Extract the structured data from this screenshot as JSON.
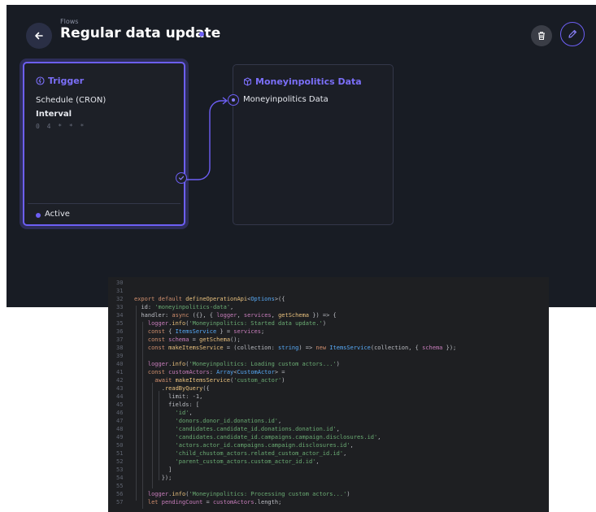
{
  "header": {
    "breadcrumb": "Flows",
    "title": "Regular data update"
  },
  "trigger": {
    "title": "Trigger",
    "type": "Schedule (CRON)",
    "field_label": "Interval",
    "field_value": "0 4 * * *",
    "status": "Active"
  },
  "operation": {
    "title": "Moneyinpolitics Data",
    "subtitle": "Moneyinpolitics Data"
  },
  "colors": {
    "accent": "#6d5ff5",
    "background": "#181c24",
    "card": "#1d2027",
    "code_background": "#1e1f22"
  },
  "icons": {
    "back": "arrow-left-icon",
    "delete": "trash-icon",
    "edit": "pencil-icon",
    "trigger": "bolt-circle-icon",
    "operation": "cube-icon"
  },
  "code": {
    "lines": [
      {
        "n": "30",
        "t": ""
      },
      {
        "n": "31",
        "t": ""
      },
      {
        "n": "32",
        "t": "export default defineOperationApi<Options>({"
      },
      {
        "n": "33",
        "t": "  id: 'moneyinpolitics-data',"
      },
      {
        "n": "34",
        "t": "  handler: async ({}, { logger, services, getSchema }) => {"
      },
      {
        "n": "35",
        "t": "    logger.info('Moneyinpolitics: Started data update.')"
      },
      {
        "n": "36",
        "t": "    const { ItemsService } = services;"
      },
      {
        "n": "37",
        "t": "    const schema = getSchema();"
      },
      {
        "n": "38",
        "t": "    const makeItemsService = (collection: string) => new ItemsService(collection, { schema });"
      },
      {
        "n": "39",
        "t": ""
      },
      {
        "n": "40",
        "t": "    logger.info('Moneyinpolitics: Loading custom actors...')"
      },
      {
        "n": "41",
        "t": "    const customActors: Array<CustomActor> ="
      },
      {
        "n": "42",
        "t": "      await makeItemsService('custom_actor')"
      },
      {
        "n": "43",
        "t": "        .readByQuery({"
      },
      {
        "n": "44",
        "t": "          limit: -1,"
      },
      {
        "n": "45",
        "t": "          fields: ["
      },
      {
        "n": "46",
        "t": "            'id',"
      },
      {
        "n": "47",
        "t": "            'donors.donor_id.donations.id',"
      },
      {
        "n": "48",
        "t": "            'candidates.candidate_id.donations.donation.id',"
      },
      {
        "n": "49",
        "t": "            'candidates.candidate_id.campaigns.campaign.disclosures.id',"
      },
      {
        "n": "50",
        "t": "            'actors.actor_id.campaigns.campaign.disclosures.id',"
      },
      {
        "n": "51",
        "t": "            'child_chustom_actors.related_custom_actor_id.id',"
      },
      {
        "n": "52",
        "t": "            'parent_custom_actors.custom_actor_id.id',"
      },
      {
        "n": "53",
        "t": "          ]"
      },
      {
        "n": "54",
        "t": "        });"
      },
      {
        "n": "55",
        "t": ""
      },
      {
        "n": "56",
        "t": "    logger.info('Moneyinpolitics: Processing custom actors...')"
      },
      {
        "n": "57",
        "t": "    let pendingCount = customActors.length;"
      }
    ]
  }
}
